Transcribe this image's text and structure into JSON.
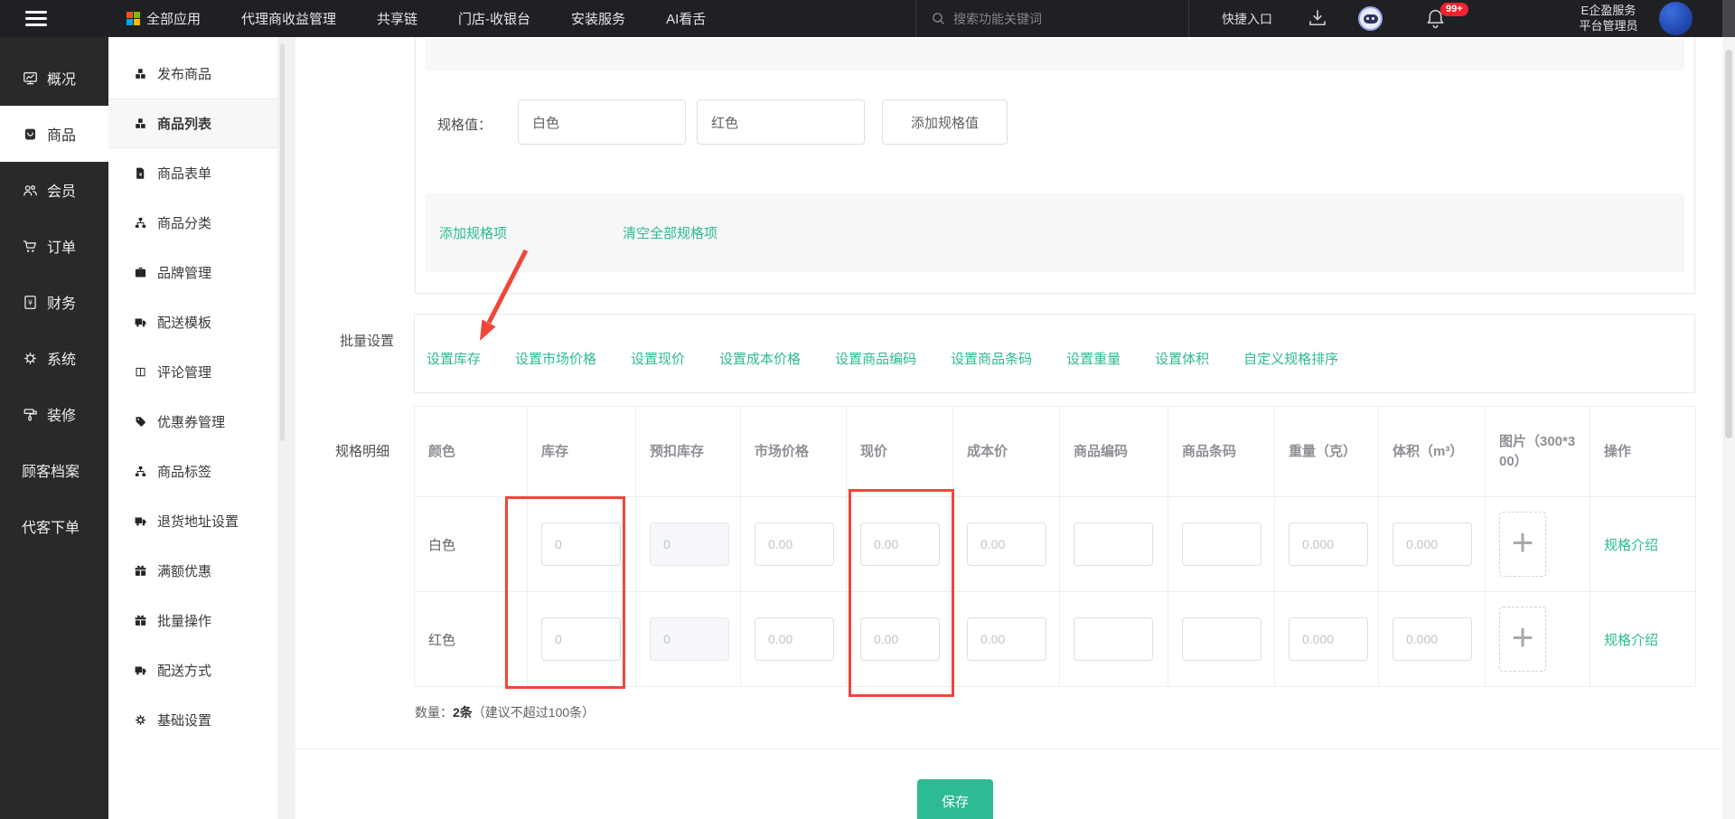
{
  "topbar": {
    "menu": [
      {
        "label": "全部应用"
      },
      {
        "label": "代理商收益管理"
      },
      {
        "label": "共享链"
      },
      {
        "label": "门店-收银台"
      },
      {
        "label": "安装服务"
      },
      {
        "label": "AI看舌"
      }
    ],
    "search_placeholder": "搜索功能关键词",
    "quick_entry": "快捷入口",
    "badge": "99+",
    "org_name": "E企盈服务",
    "role": "平台管理员"
  },
  "sidebar": {
    "items": [
      {
        "label": "概况"
      },
      {
        "label": "商品",
        "active": true
      },
      {
        "label": "会员"
      },
      {
        "label": "订单"
      },
      {
        "label": "财务"
      },
      {
        "label": "系统"
      },
      {
        "label": "装修"
      },
      {
        "label": "顾客档案"
      },
      {
        "label": "代客下单"
      }
    ]
  },
  "submenu": {
    "items": [
      {
        "label": "发布商品"
      },
      {
        "label": "商品列表",
        "active": true
      },
      {
        "label": "商品表单"
      },
      {
        "label": "商品分类"
      },
      {
        "label": "品牌管理"
      },
      {
        "label": "配送模板"
      },
      {
        "label": "评论管理"
      },
      {
        "label": "优惠券管理"
      },
      {
        "label": "商品标签"
      },
      {
        "label": "退货地址设置"
      },
      {
        "label": "满额优惠"
      },
      {
        "label": "批量操作"
      },
      {
        "label": "配送方式"
      },
      {
        "label": "基础设置"
      }
    ]
  },
  "content": {
    "spec_value_label": "规格值：",
    "spec_values": [
      "白色",
      "红色"
    ],
    "add_spec_value_btn": "添加规格值",
    "add_spec_item_link": "添加规格项",
    "clear_spec_items_link": "清空全部规格项",
    "batch_label": "批量设置",
    "batch_links": [
      "设置库存",
      "设置市场价格",
      "设置现价",
      "设置成本价格",
      "设置商品编码",
      "设置商品条码",
      "设置重量",
      "设置体积",
      "自定义规格排序"
    ],
    "detail_label": "规格明细",
    "table": {
      "headers": [
        "颜色",
        "库存",
        "预扣库存",
        "市场价格",
        "现价",
        "成本价",
        "商品编码",
        "商品条码",
        "重量（克）",
        "体积（m³）",
        "图片（300*300）",
        "操作"
      ],
      "rows": [
        {
          "name": "白色",
          "stock": "0",
          "withhold": "0",
          "market": "0.00",
          "price": "0.00",
          "cost": "0.00",
          "code": "",
          "barcode": "",
          "weight": "0.000",
          "volume": "0.000",
          "action": "规格介绍"
        },
        {
          "name": "红色",
          "stock": "0",
          "withhold": "0",
          "market": "0.00",
          "price": "0.00",
          "cost": "0.00",
          "code": "",
          "barcode": "",
          "weight": "0.000",
          "volume": "0.000",
          "action": "规格介绍"
        }
      ]
    },
    "qty_prefix": "数量：",
    "qty_value": "2条",
    "qty_hint": "（建议不超过100条）",
    "save_btn": "保存"
  },
  "icons": {
    "hamburger-icon": "☰",
    "apps-grid-icon": "colored 2x2 grid",
    "search-icon": "magnifier",
    "download-icon": "tray down-arrow",
    "robot-assistant-icon": "robot face",
    "bell-icon": "bell",
    "plus-icon": "+"
  },
  "colors": {
    "accent": "#2cbb92",
    "annotation": "#f1453a",
    "topbar_bg": "#1f2023",
    "sidebar_bg": "#29292b"
  }
}
